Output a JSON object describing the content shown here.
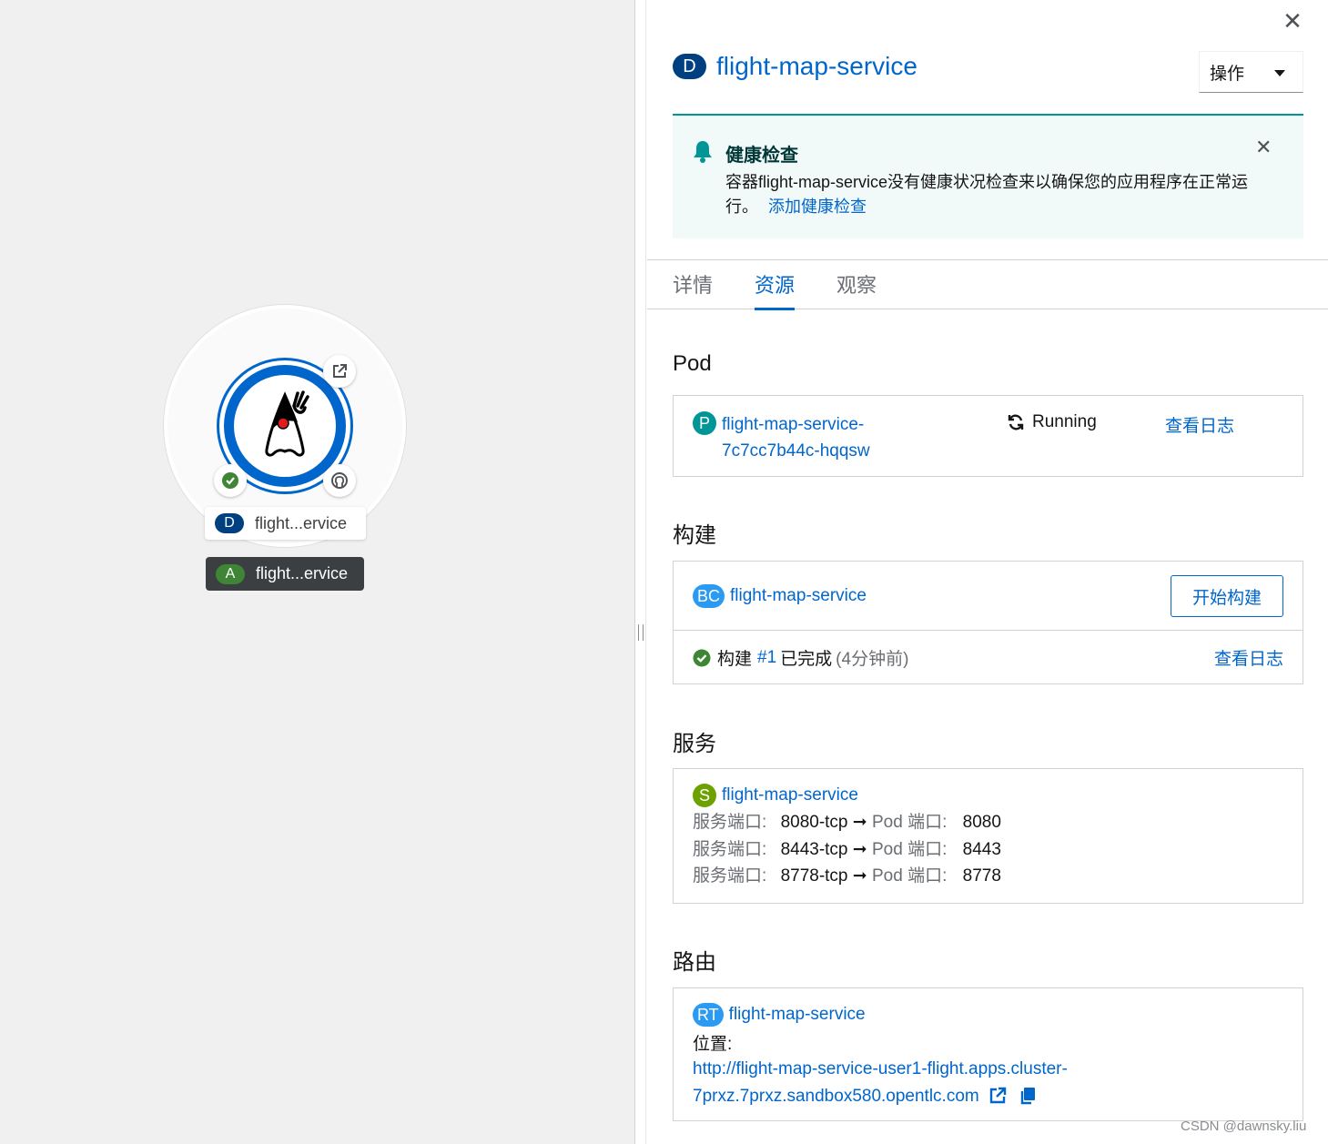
{
  "topology": {
    "node_label": {
      "badge": "D",
      "name": "flight...ervice"
    },
    "app_label": {
      "badge": "A",
      "name": "flight...ervice"
    },
    "colors": {
      "deployment_badge": "#004080",
      "app_badge": "#3e8635",
      "ring": "#0066cc"
    }
  },
  "panel": {
    "close": "✕",
    "title_badge": "D",
    "title": "flight-map-service",
    "actions_label": "操作",
    "alert": {
      "title": "健康检查",
      "close": "✕",
      "message": "容器flight-map-service没有健康状况检查来以确保您的应用程序在正常运行。",
      "link": "添加健康检查"
    },
    "tabs": [
      {
        "label": "详情"
      },
      {
        "label": "资源"
      },
      {
        "label": "观察"
      }
    ],
    "active_tab": "资源",
    "pod": {
      "heading": "Pod",
      "badge": "P",
      "name_line1": "flight-map-service-",
      "name_line2": "7c7cc7b44c-hqqsw",
      "status": "Running",
      "logs_link": "查看日志"
    },
    "build": {
      "heading": "构建",
      "badge": "BC",
      "name": "flight-map-service",
      "start_button": "开始构建",
      "run_prefix": "构建",
      "run_number": "#1",
      "run_status": "已完成",
      "run_time": "(4分钟前)",
      "logs_link": "查看日志"
    },
    "service": {
      "heading": "服务",
      "badge": "S",
      "name": "flight-map-service",
      "service_port_label": "服务端口:",
      "pod_port_label": "Pod 端口:",
      "ports": [
        {
          "service": "8080-tcp",
          "pod": "8080"
        },
        {
          "service": "8443-tcp",
          "pod": "8443"
        },
        {
          "service": "8778-tcp",
          "pod": "8778"
        }
      ]
    },
    "route": {
      "heading": "路由",
      "badge": "RT",
      "name": "flight-map-service",
      "location_label": "位置:",
      "url_line1": "http://flight-map-service-user1-flight.apps.cluster-",
      "url_line2": "7prxz.7prxz.sandbox580.opentlc.com"
    }
  },
  "watermark": "CSDN @dawnsky.liu",
  "colors": {
    "link": "#0066cc",
    "pod_badge": "#009596",
    "bc_badge": "#2b9af3",
    "service_badge": "#6ca100",
    "route_badge": "#2b9af3",
    "success": "#3e8635",
    "alert_bg": "#f2f9f9",
    "alert_accent": "#009596"
  }
}
